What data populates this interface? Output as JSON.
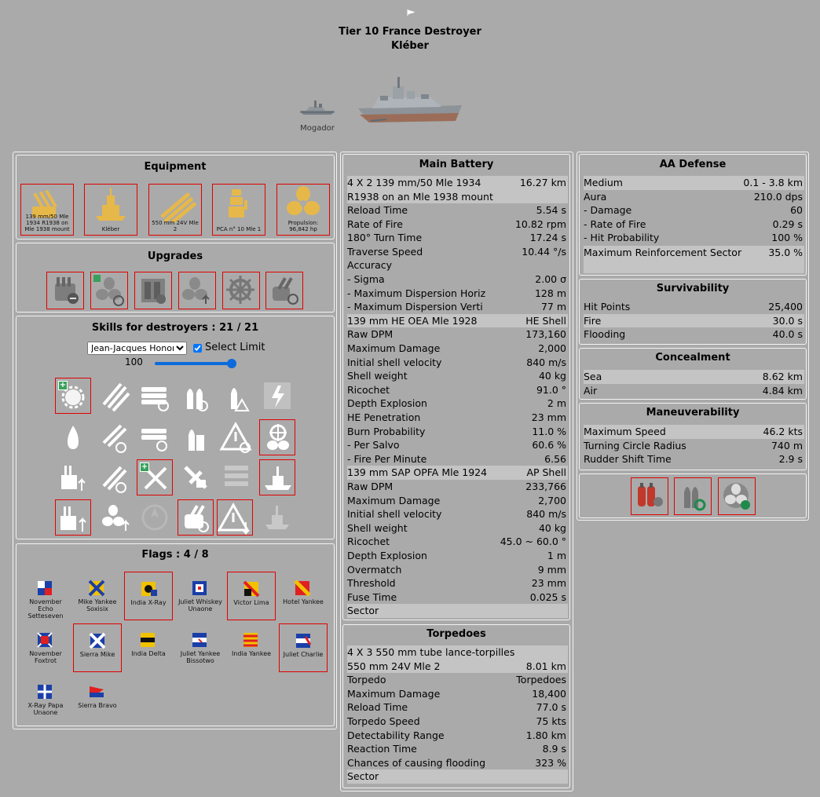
{
  "header": {
    "tier_line": "Tier 10 France Destroyer",
    "ship_name": "Kléber",
    "prev_ship": "Mogador"
  },
  "equipment": {
    "title": "Equipment",
    "slots": [
      {
        "label": "139 mm/50 Mle 1934 R1938 on Mle 1938 mount"
      },
      {
        "label": "Kléber"
      },
      {
        "label": "550 mm 24V Mle 2"
      },
      {
        "label": "PCA n° 10 Mle 1"
      },
      {
        "label": "Propulsion: 96,842 hp"
      }
    ]
  },
  "upgrades": {
    "title": "Upgrades",
    "icons": [
      "main-armaments-mod-icon",
      "engine-room-protection-icon",
      "torpedo-tubes-mod-icon",
      "propulsion-mod-icon",
      "steering-gears-mod-icon",
      "torpedo-reload-mod-icon"
    ]
  },
  "skills": {
    "title": "Skills for destroyers : 21 / 21",
    "commander": "Jean-Jacques Honoré",
    "select_limit": "Select Limit",
    "level": "100"
  },
  "flags": {
    "title": "Flags : 4 / 8",
    "items": [
      {
        "label": "November Echo Setteseven"
      },
      {
        "label": "Mike Yankee Soxisix"
      },
      {
        "label": "India X-Ray"
      },
      {
        "label": "Juliet Whiskey Unaone"
      },
      {
        "label": "Victor Lima"
      },
      {
        "label": "Hotel Yankee"
      },
      {
        "label": "November Foxtrot"
      },
      {
        "label": "Sierra Mike"
      },
      {
        "label": "India Delta"
      },
      {
        "label": "Juliet Yankee Bissotwo"
      },
      {
        "label": "India Yankee"
      },
      {
        "label": "Juliet Charlie"
      },
      {
        "label": "X-Ray Papa Unaone"
      },
      {
        "label": "Sierra Bravo"
      }
    ]
  },
  "main_battery": {
    "title": "Main Battery",
    "gun_desc": "4 X 2 139 mm/50 Mle 1934 R1938 on an Mle 1938 mount",
    "gun_range": "16.27 km",
    "rows": [
      {
        "k": "Reload Time",
        "v": "5.54 s"
      },
      {
        "k": "Rate of Fire",
        "v": "10.82 rpm"
      },
      {
        "k": "180° Turn Time",
        "v": "17.24 s"
      },
      {
        "k": "Traverse Speed",
        "v": "10.44 °/s"
      },
      {
        "k": "Accuracy",
        "v": ""
      },
      {
        "k": "- Sigma",
        "v": "2.00 σ"
      },
      {
        "k": "- Maximum Dispersion Horiz",
        "v": "128 m"
      },
      {
        "k": "- Maximum Dispersion Verti",
        "v": "77 m"
      },
      {
        "k": "139 mm HE OEA Mle 1928",
        "v": "HE Shell"
      },
      {
        "k": "Raw DPM",
        "v": "173,160"
      },
      {
        "k": "Maximum Damage",
        "v": "2,000"
      },
      {
        "k": "Initial shell velocity",
        "v": "840 m/s"
      },
      {
        "k": "Shell weight",
        "v": "40 kg"
      },
      {
        "k": "Ricochet",
        "v": "91.0 °"
      },
      {
        "k": "Depth Explosion",
        "v": "2 m"
      },
      {
        "k": "HE Penetration",
        "v": "23 mm"
      },
      {
        "k": "Burn Probability",
        "v": "11.0 %"
      },
      {
        "k": "- Per Salvo",
        "v": "60.6 %"
      },
      {
        "k": "- Fire Per Minute",
        "v": "6.56"
      },
      {
        "k": "139 mm SAP OPFA Mle 1924",
        "v": "AP Shell"
      },
      {
        "k": "Raw DPM",
        "v": "233,766"
      },
      {
        "k": "Maximum Damage",
        "v": "2,700"
      },
      {
        "k": "Initial shell velocity",
        "v": "840 m/s"
      },
      {
        "k": "Shell weight",
        "v": "40 kg"
      },
      {
        "k": "Ricochet",
        "v": "45.0 ~ 60.0 °"
      },
      {
        "k": "Depth Explosion",
        "v": "1 m"
      },
      {
        "k": "Overmatch",
        "v": "9 mm"
      },
      {
        "k": "Threshold",
        "v": "23 mm"
      },
      {
        "k": "Fuse Time",
        "v": "0.025 s"
      },
      {
        "k": "Sector",
        "v": ""
      }
    ]
  },
  "torpedoes": {
    "title": "Torpedoes",
    "rows": [
      {
        "k": "4 X 3 550 mm tube lance-torpilles",
        "v": ""
      },
      {
        "k": "550 mm 24V Mle 2",
        "v": "8.01 km"
      },
      {
        "k": "Torpedo",
        "v": "Torpedoes"
      },
      {
        "k": "Maximum Damage",
        "v": "18,400"
      },
      {
        "k": "Reload Time",
        "v": "77.0 s"
      },
      {
        "k": "Torpedo Speed",
        "v": "75 kts"
      },
      {
        "k": "Detectability Range",
        "v": "1.80 km"
      },
      {
        "k": "Reaction Time",
        "v": "8.9 s"
      },
      {
        "k": "Chances of causing flooding",
        "v": "323 %"
      },
      {
        "k": "Sector",
        "v": ""
      }
    ]
  },
  "aa_defense": {
    "title": "AA Defense",
    "rows": [
      {
        "k": "Medium",
        "v": "0.1 - 3.8 km"
      },
      {
        "k": "Aura",
        "v": "210.0 dps"
      },
      {
        "k": "- Damage",
        "v": "60"
      },
      {
        "k": "- Rate of Fire",
        "v": "0.29 s"
      },
      {
        "k": "- Hit Probability",
        "v": "100 %"
      }
    ],
    "reinforcement_label": "Maximum Reinforcement Sector",
    "reinforcement_value": "35.0 %"
  },
  "survivability": {
    "title": "Survivability",
    "rows": [
      {
        "k": "Hit Points",
        "v": "25,400"
      },
      {
        "k": "Fire",
        "v": "30.0 s"
      },
      {
        "k": "Flooding",
        "v": "40.0 s"
      }
    ]
  },
  "concealment": {
    "title": "Concealment",
    "rows": [
      {
        "k": "Sea",
        "v": "8.62 km"
      },
      {
        "k": "Air",
        "v": "4.84 km"
      }
    ]
  },
  "maneuverability": {
    "title": "Maneuverability",
    "rows": [
      {
        "k": "Maximum Speed",
        "v": "46.2 kts"
      },
      {
        "k": "Turning Circle Radius",
        "v": "740 m"
      },
      {
        "k": "Rudder Shift Time",
        "v": "2.9 s"
      }
    ]
  },
  "consumables": [
    "damage-control-party-icon",
    "main-battery-reload-booster-icon",
    "engine-boost-icon"
  ]
}
